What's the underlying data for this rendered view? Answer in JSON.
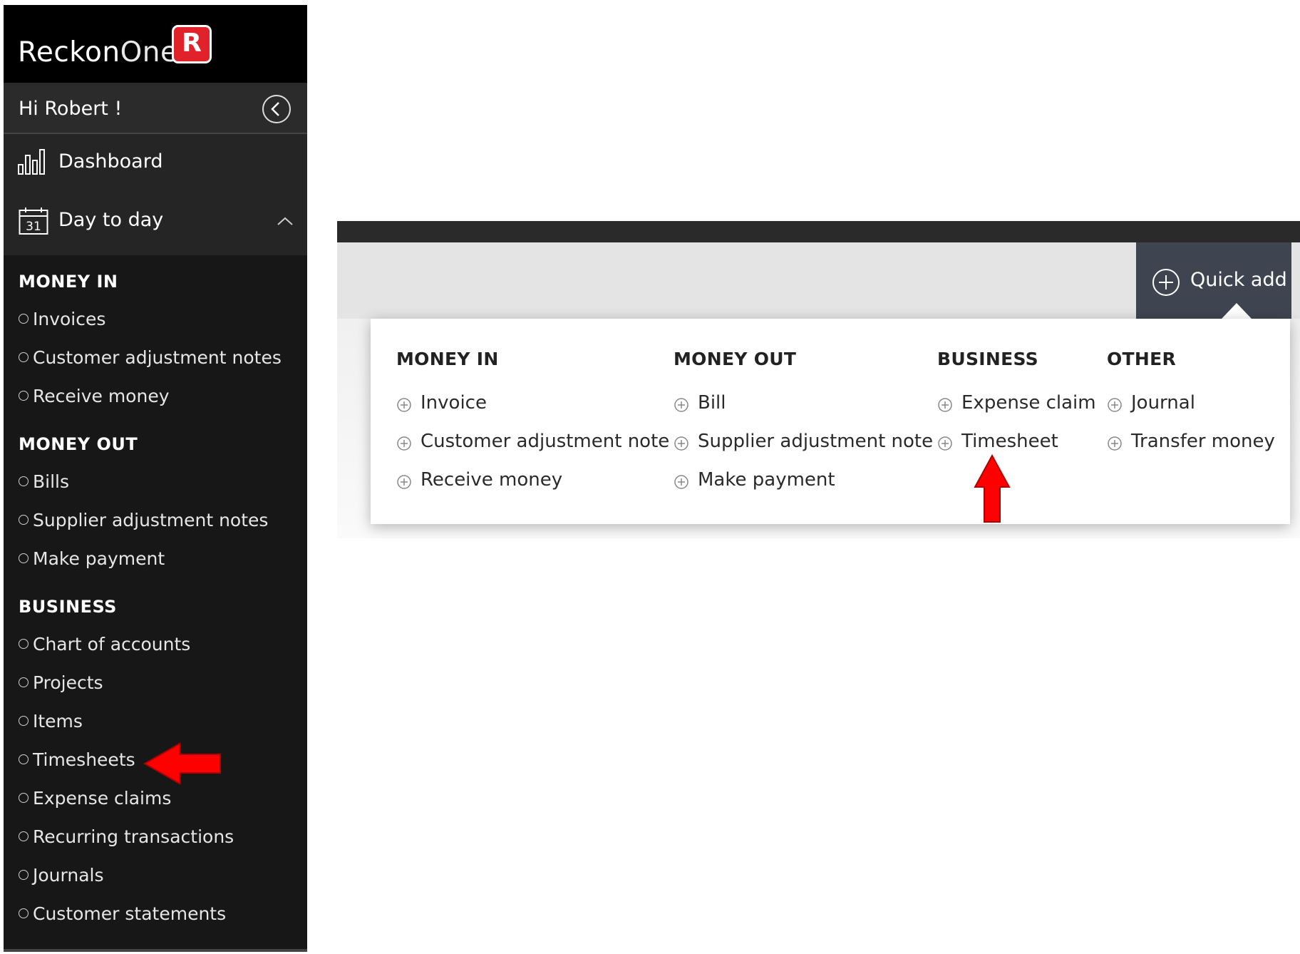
{
  "brand": {
    "name_part1": "Reckon",
    "name_part2": "One",
    "badge": "R"
  },
  "sidebar": {
    "greeting": "Hi Robert !",
    "nav": [
      {
        "label": "Dashboard",
        "icon": "bar-chart-icon"
      },
      {
        "label": "Day to day",
        "icon": "calendar-icon",
        "calendar_day": "31"
      }
    ],
    "sections": [
      {
        "title": "MONEY IN",
        "items": [
          "Invoices",
          "Customer adjustment notes",
          "Receive money"
        ]
      },
      {
        "title": "MONEY OUT",
        "items": [
          "Bills",
          "Supplier adjustment notes",
          "Make payment"
        ]
      },
      {
        "title": "BUSINESS",
        "items": [
          "Chart of accounts",
          "Projects",
          "Items",
          "Timesheets",
          "Expense claims",
          "Recurring transactions",
          "Journals",
          "Customer statements"
        ]
      }
    ]
  },
  "quick_add": {
    "label": "Quick add",
    "columns": [
      {
        "title": "MONEY IN",
        "items": [
          "Invoice",
          "Customer adjustment note",
          "Receive money"
        ]
      },
      {
        "title": "MONEY OUT",
        "items": [
          "Bill",
          "Supplier adjustment note",
          "Make payment"
        ]
      },
      {
        "title": "BUSINESS",
        "items": [
          "Expense claim",
          "Timesheet"
        ]
      },
      {
        "title": "OTHER",
        "items": [
          "Journal",
          "Transfer money"
        ]
      }
    ]
  },
  "colors": {
    "sidebar_bg": "#171717",
    "brand_red": "#e1222a",
    "annotation_arrow": "#ff0000",
    "quick_add_bg": "#3e4551"
  }
}
